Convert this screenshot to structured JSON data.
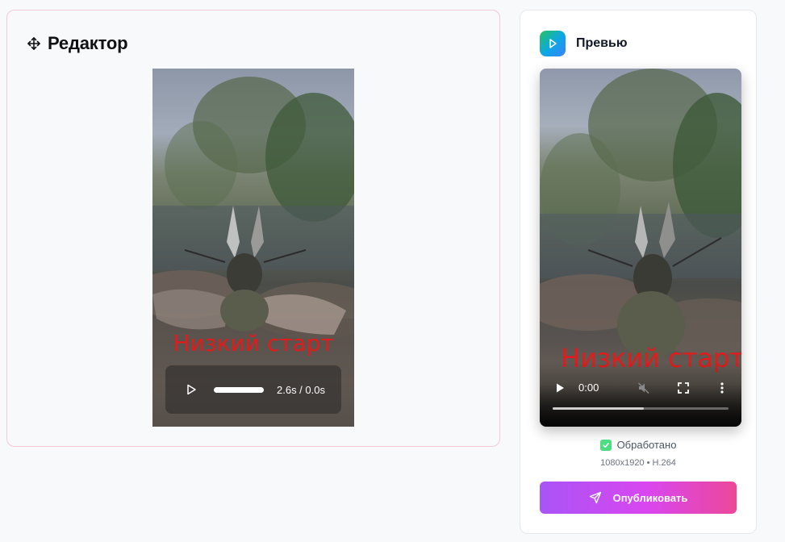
{
  "editor": {
    "title": "Редактор",
    "overlay_text": "Низкий старт",
    "player": {
      "time_display": "2.6s / 0.0s"
    }
  },
  "preview": {
    "title": "Превью",
    "overlay_text": "Низкий старт",
    "player": {
      "current_time": "0:00",
      "progress": 0.52
    },
    "status": {
      "label": "Обработано",
      "color": "#4ade80"
    },
    "meta": "1080x1920 • H.264",
    "publish_label": "Опубликовать"
  },
  "colors": {
    "overlay_text": "#e21b1b",
    "publish_gradient_start": "#a855f7",
    "publish_gradient_end": "#ec4899",
    "editor_border": "#f3c9d4"
  }
}
